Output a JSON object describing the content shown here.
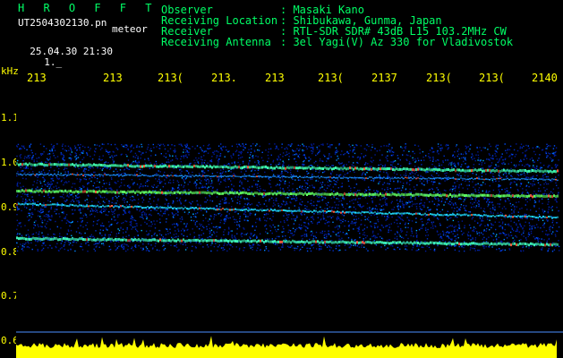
{
  "header": {
    "brand": "H R O F F T",
    "filename": "UT2504302130.pn",
    "filename_suffix": "meteor",
    "date_time": "25.04.30 21:30",
    "small_code": "1._"
  },
  "info": [
    {
      "label": "Observer",
      "value": ": Masaki Kano"
    },
    {
      "label": "Receiving Location",
      "value": ": Shibukawa, Gunma, Japan"
    },
    {
      "label": "Receiver",
      "value": ": RTL-SDR SDR# 43dB L15 103.2MHz CW"
    },
    {
      "label": "Receiving Antenna",
      "value": ": 3el Yagi(V) Az 330 for Vladivostok"
    }
  ],
  "axes": {
    "y_unit": "kHz",
    "y_ticks": [
      "1.1",
      "1.0",
      "0.9",
      "0.8",
      "0.7",
      "0.6"
    ],
    "x_ticks": [
      "213",
      "213",
      "213(",
      "213.",
      "213",
      "213(",
      "2137",
      "213(",
      "213(",
      "2140"
    ]
  },
  "colors": {
    "background": "#000000",
    "text_green": "#00ff66",
    "text_yellow": "#ffff00",
    "signal_yellow": "#ffff00",
    "baseline_line": "#4a90ff"
  }
}
